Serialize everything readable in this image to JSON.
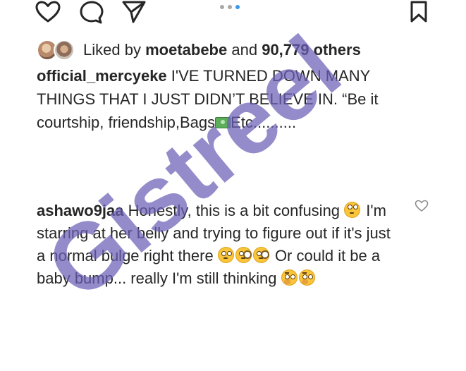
{
  "action_bar": {
    "icons": [
      "heart-icon",
      "comment-icon",
      "share-icon",
      "bookmark-icon"
    ],
    "carousel": {
      "count": 3,
      "active_index": 2
    }
  },
  "likes": {
    "prefix": "Liked by",
    "user": "moetabebe",
    "conjunction": "and",
    "count_text": "90,779 others"
  },
  "caption": {
    "username": "official_mercyeke",
    "text_1": " I'VE TURNED DOWN MANY THINGS THAT I JUST DIDN’T BELIEVE IN. “Be it courtship, friendship,Bags",
    "emoji": "money-emoji",
    "text_2": "Etc.........."
  },
  "comment": {
    "username": "ashawo9jaa",
    "text_1": " Honestly, this is a bit confusing ",
    "text_2": " I'm starring at her belly and trying to figure out if it's just a normal bulge right there ",
    "text_3": " Or could it be a baby bump... really I'm still thinking",
    "emojis": [
      "eye-roll-emoji",
      "flushed-emoji",
      "monocle-emoji",
      "thinking-emoji"
    ]
  },
  "watermark": {
    "text": "Gistreel",
    "color": "#6b5fb5"
  },
  "colors": {
    "text": "#262626",
    "accent_blue": "#3897f0"
  }
}
